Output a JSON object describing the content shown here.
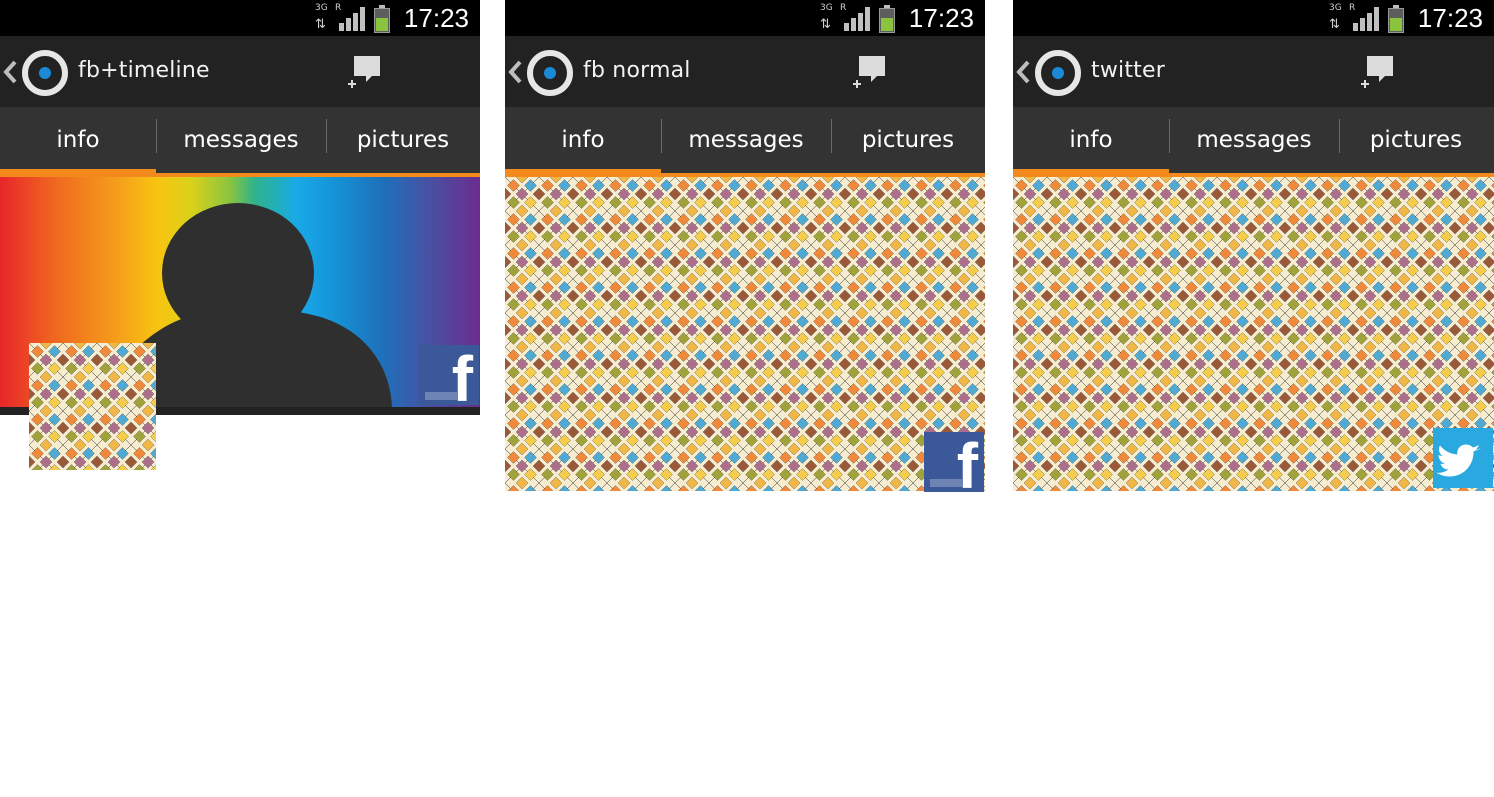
{
  "colors": {
    "status_bar": "#000000",
    "action_bar": "#222222",
    "tab_bar": "#333333",
    "tab_indicator": "#f38a1e",
    "facebook_blue": "#3b5998",
    "twitter_blue": "#2aa9e0",
    "logo_dot": "#1a8ad8"
  },
  "screens": [
    {
      "status": {
        "network": "3G",
        "roaming": "R",
        "battery_level": 0.58,
        "time": "17:23"
      },
      "title": "fb+timeline",
      "tabs": [
        {
          "label": "info",
          "selected": true
        },
        {
          "label": "messages",
          "selected": false
        },
        {
          "label": "pictures",
          "selected": false
        }
      ],
      "cover": "rainbow-gradient-with-silhouette",
      "network_badge": "facebook-icon"
    },
    {
      "status": {
        "network": "3G",
        "roaming": "R",
        "battery_level": 0.58,
        "time": "17:23"
      },
      "title": "fb normal",
      "tabs": [
        {
          "label": "info",
          "selected": true
        },
        {
          "label": "messages",
          "selected": false
        },
        {
          "label": "pictures",
          "selected": false
        }
      ],
      "cover": "diamond-mosaic-pattern",
      "network_badge": "facebook-icon"
    },
    {
      "status": {
        "network": "3G",
        "roaming": "R",
        "battery_level": 0.58,
        "time": "17:23"
      },
      "title": "twitter",
      "tabs": [
        {
          "label": "info",
          "selected": true
        },
        {
          "label": "messages",
          "selected": false
        },
        {
          "label": "pictures",
          "selected": false
        }
      ],
      "cover": "diamond-mosaic-pattern",
      "network_badge": "twitter-icon"
    }
  ]
}
